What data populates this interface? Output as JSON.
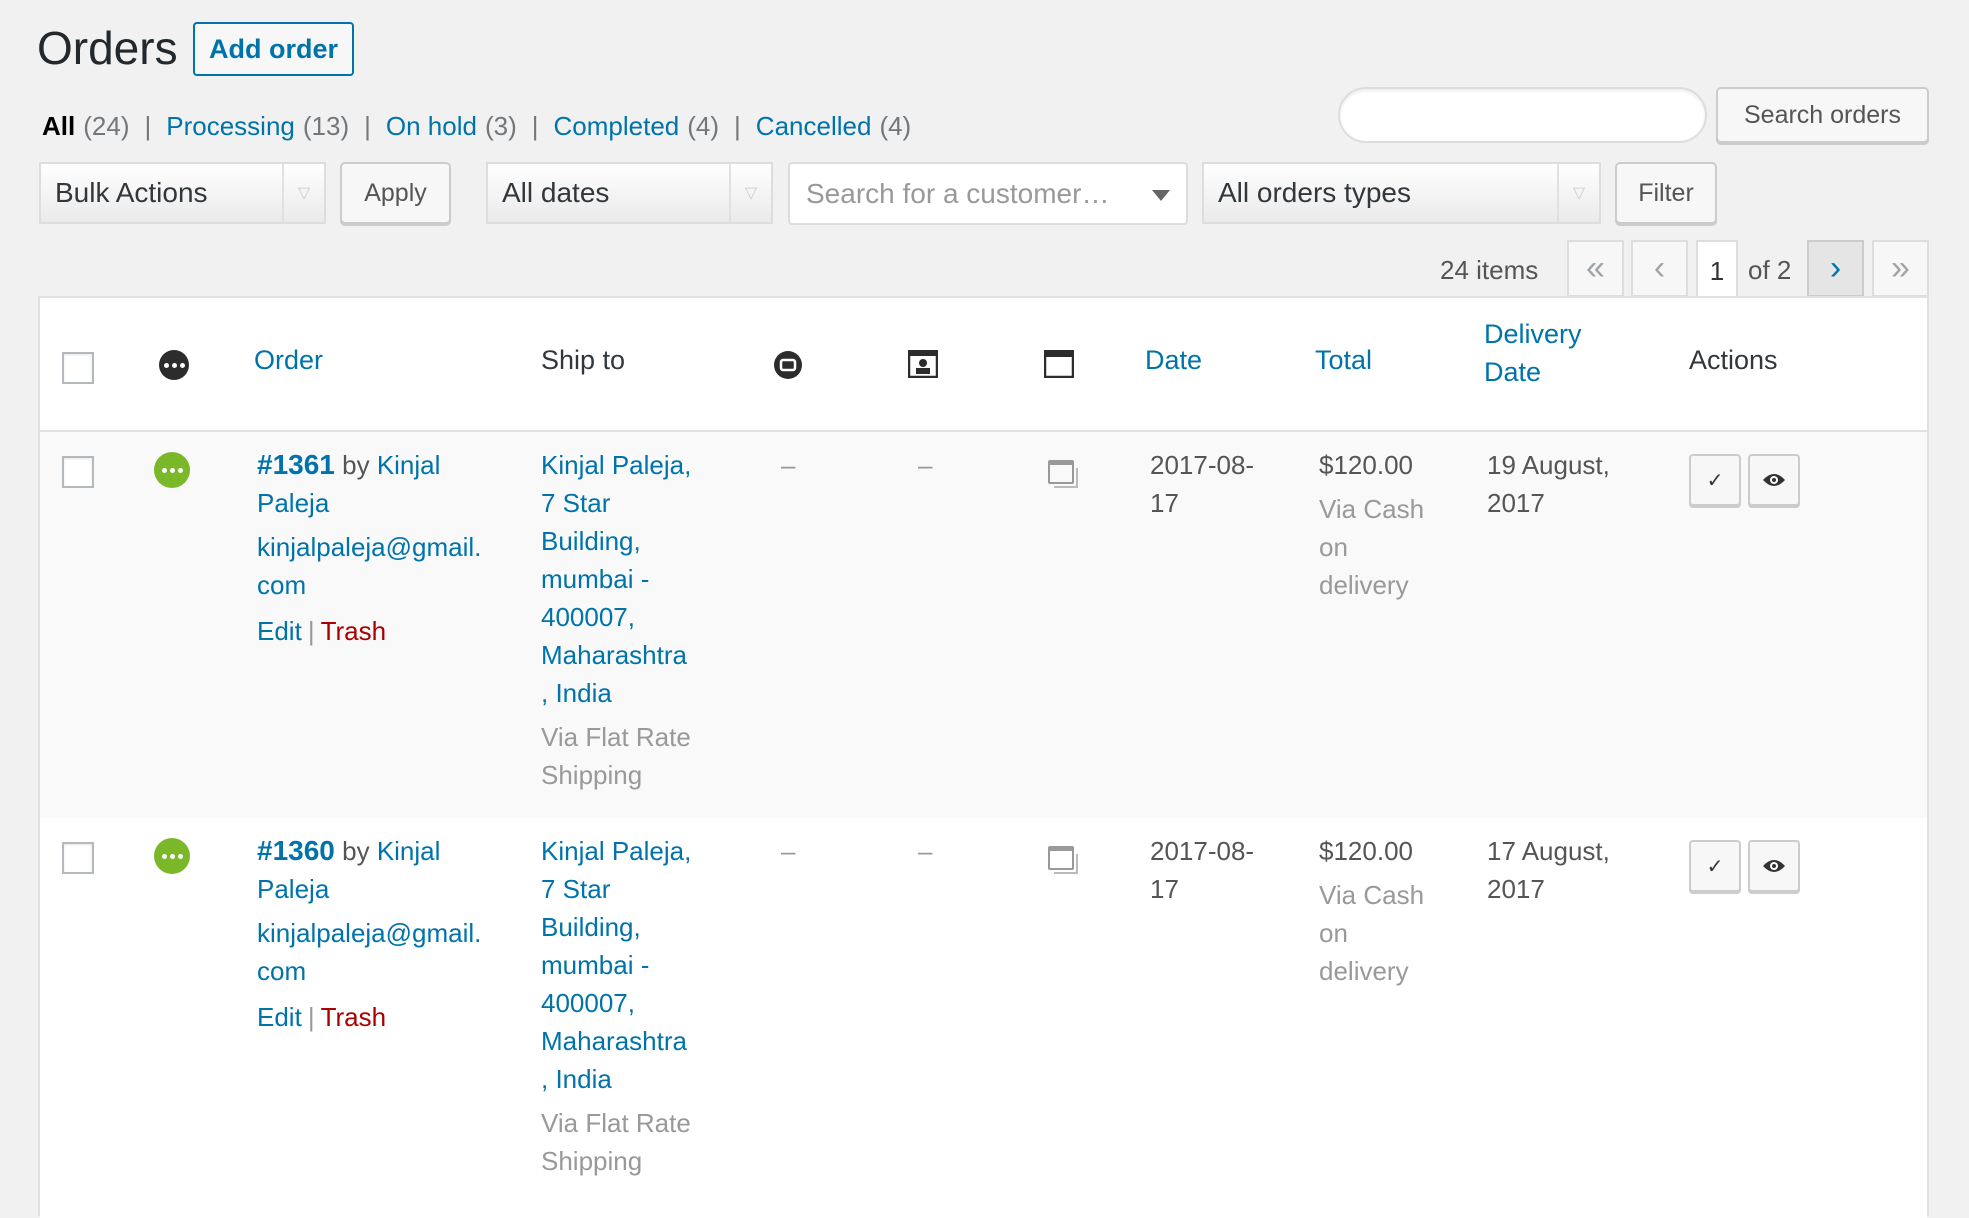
{
  "header": {
    "title": "Orders",
    "add_label": "Add order"
  },
  "filters": {
    "all_label": "All",
    "all_count": "(24)",
    "processing_label": "Processing",
    "processing_count": "(13)",
    "onhold_label": "On hold",
    "onhold_count": "(3)",
    "completed_label": "Completed",
    "completed_count": "(4)",
    "cancelled_label": "Cancelled",
    "cancelled_count": "(4)",
    "separator": "|"
  },
  "search": {
    "value": "",
    "button": "Search orders"
  },
  "toolbar": {
    "bulk_actions": "Bulk Actions",
    "apply": "Apply",
    "dates": "All dates",
    "customer_placeholder": "Search for a customer…",
    "order_types": "All orders types",
    "filter": "Filter"
  },
  "pagination": {
    "items": "24 items",
    "first": "«",
    "prev": "‹",
    "current": "1",
    "of": "of 2",
    "next": "›",
    "last": "»"
  },
  "columns": {
    "order": "Order",
    "ship_to": "Ship to",
    "date": "Date",
    "total": "Total",
    "delivery_line1": "Delivery",
    "delivery_line2": "Date",
    "actions": "Actions"
  },
  "orders": [
    {
      "number": "#1361",
      "by": "by",
      "name_line1": "Kinjal",
      "name_line2": "Paleja",
      "email_line1": "kinjalpaleja@gmail.",
      "email_line2": "com",
      "edit": "Edit",
      "trash": "Trash",
      "pipe": "|",
      "ship_lines": [
        "Kinjal Paleja,",
        "7 Star",
        "Building,",
        "mumbai -",
        "400007,",
        "Maharashtra",
        ", India"
      ],
      "ship_via_lines": [
        "Via Flat Rate",
        "Shipping"
      ],
      "dash1": "–",
      "dash2": "–",
      "date_line1": "2017-08-",
      "date_line2": "17",
      "total": "$120.00",
      "pay_lines": [
        "Via Cash",
        "on",
        "delivery"
      ],
      "delivery_line1": "19 August,",
      "delivery_line2": "2017",
      "complete_icon": "✓",
      "view_icon": "👁"
    },
    {
      "number": "#1360",
      "by": "by",
      "name_line1": "Kinjal",
      "name_line2": "Paleja",
      "email_line1": "kinjalpaleja@gmail.",
      "email_line2": "com",
      "edit": "Edit",
      "trash": "Trash",
      "pipe": "|",
      "ship_lines": [
        "Kinjal Paleja,",
        "7 Star",
        "Building,",
        "mumbai -",
        "400007,",
        "Maharashtra",
        ", India"
      ],
      "ship_via_lines": [
        "Via Flat Rate",
        "Shipping"
      ],
      "dash1": "–",
      "dash2": "–",
      "date_line1": "2017-08-",
      "date_line2": "17",
      "total": "$120.00",
      "pay_lines": [
        "Via Cash",
        "on",
        "delivery"
      ],
      "delivery_line1": "17 August,",
      "delivery_line2": "2017",
      "complete_icon": "✓",
      "view_icon": "👁"
    }
  ],
  "colors": {
    "link": "#0073aa",
    "trash": "#aa0000",
    "status_processing": "#7ab829"
  }
}
